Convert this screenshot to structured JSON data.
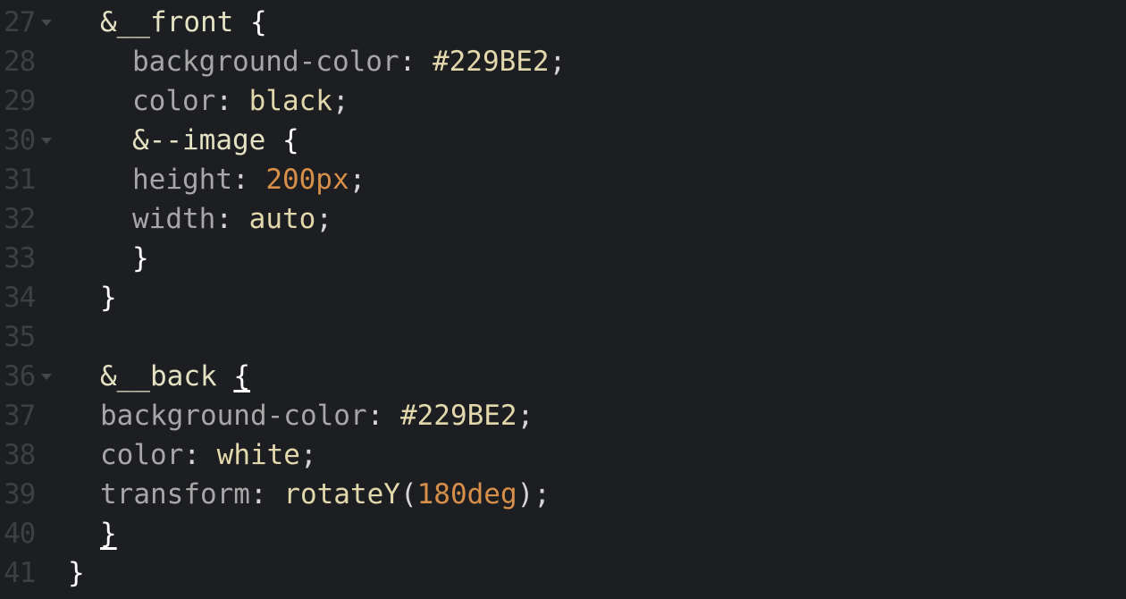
{
  "editor": {
    "colors": {
      "background": "#1d1e22",
      "gutter_text": "#3d3f45",
      "property": "#a7a7a7",
      "value": "#e2d8ac",
      "number": "#d78f4a",
      "selector": "#e5e2c4",
      "brace": "#ffffff"
    },
    "lines": [
      {
        "n": "27",
        "fold": true,
        "indent": 3,
        "tokens": [
          {
            "t": "&__front",
            "c": "sel"
          },
          {
            "t": " "
          },
          {
            "t": "{",
            "c": "brace"
          }
        ]
      },
      {
        "n": "28",
        "fold": false,
        "indent": 4,
        "tokens": [
          {
            "t": "background-color",
            "c": "prop"
          },
          {
            "t": ": ",
            "c": "punc"
          },
          {
            "t": "#229BE2",
            "c": "val"
          },
          {
            "t": ";",
            "c": "punc"
          }
        ]
      },
      {
        "n": "29",
        "fold": false,
        "indent": 4,
        "tokens": [
          {
            "t": "color",
            "c": "prop"
          },
          {
            "t": ": ",
            "c": "punc"
          },
          {
            "t": "black",
            "c": "val"
          },
          {
            "t": ";",
            "c": "punc"
          }
        ]
      },
      {
        "n": "30",
        "fold": true,
        "indent": 4,
        "tokens": [
          {
            "t": "&--image",
            "c": "sel"
          },
          {
            "t": " "
          },
          {
            "t": "{",
            "c": "brace"
          }
        ]
      },
      {
        "n": "31",
        "fold": false,
        "indent": 4,
        "tokens": [
          {
            "t": "height",
            "c": "prop"
          },
          {
            "t": ": ",
            "c": "punc"
          },
          {
            "t": "200px",
            "c": "num"
          },
          {
            "t": ";",
            "c": "punc"
          }
        ]
      },
      {
        "n": "32",
        "fold": false,
        "indent": 4,
        "tokens": [
          {
            "t": "width",
            "c": "prop"
          },
          {
            "t": ": ",
            "c": "punc"
          },
          {
            "t": "auto",
            "c": "val"
          },
          {
            "t": ";",
            "c": "punc"
          }
        ]
      },
      {
        "n": "33",
        "fold": false,
        "indent": 4,
        "tokens": [
          {
            "t": "}",
            "c": "brace"
          }
        ]
      },
      {
        "n": "34",
        "fold": false,
        "indent": 3,
        "tokens": [
          {
            "t": "}",
            "c": "brace"
          }
        ]
      },
      {
        "n": "35",
        "fold": false,
        "indent": 0,
        "tokens": []
      },
      {
        "n": "36",
        "fold": true,
        "indent": 3,
        "tokens": [
          {
            "t": "&__back",
            "c": "sel"
          },
          {
            "t": " "
          },
          {
            "t": "{",
            "c": "brace u"
          }
        ]
      },
      {
        "n": "37",
        "fold": false,
        "indent": 3,
        "tokens": [
          {
            "t": "background-color",
            "c": "prop"
          },
          {
            "t": ": ",
            "c": "punc"
          },
          {
            "t": "#229BE2",
            "c": "val"
          },
          {
            "t": ";",
            "c": "punc"
          }
        ]
      },
      {
        "n": "38",
        "fold": false,
        "indent": 3,
        "tokens": [
          {
            "t": "color",
            "c": "prop"
          },
          {
            "t": ": ",
            "c": "punc"
          },
          {
            "t": "white",
            "c": "val"
          },
          {
            "t": ";",
            "c": "punc"
          }
        ]
      },
      {
        "n": "39",
        "fold": false,
        "indent": 3,
        "tokens": [
          {
            "t": "transform",
            "c": "prop"
          },
          {
            "t": ": ",
            "c": "punc"
          },
          {
            "t": "rotateY",
            "c": "val"
          },
          {
            "t": "(",
            "c": "punc"
          },
          {
            "t": "180deg",
            "c": "num"
          },
          {
            "t": ");",
            "c": "punc"
          }
        ]
      },
      {
        "n": "40",
        "fold": false,
        "indent": 3,
        "tokens": [
          {
            "t": "}",
            "c": "brace u"
          }
        ]
      },
      {
        "n": "41",
        "fold": false,
        "indent": 2,
        "tokens": [
          {
            "t": "}",
            "c": "brace"
          }
        ]
      }
    ]
  }
}
